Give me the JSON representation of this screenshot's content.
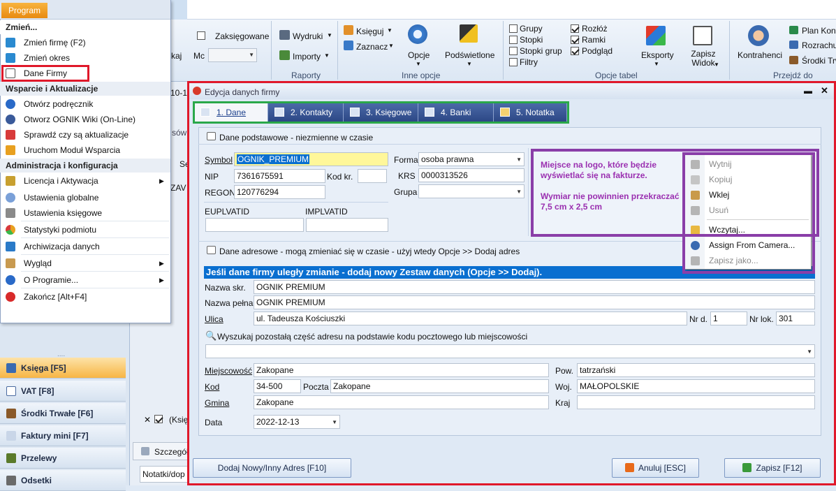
{
  "ribbon": {
    "zaksiegowane": "Zaksięgowane",
    "mc": "Mc",
    "kaj": "kaj",
    "wydruki": "Wydruki",
    "importy": "Importy",
    "raporty": "Raporty",
    "ksieguj": "Księguj",
    "zaznacz": "Zaznacz",
    "opcje": "Opcje",
    "podswietlone": "Podświetlone",
    "inne_opcje": "Inne opcje",
    "grupy": "Grupy",
    "stopki": "Stopki",
    "stopki_grup": "Stopki grup",
    "filtry": "Filtry",
    "rozloz": "Rozłóż",
    "ramki": "Ramki",
    "podglad": "Podgląd",
    "opcje_tabel": "Opcje tabel",
    "eksporty": "Eksporty",
    "zapisz_widok": "Zapisz Widok",
    "kontrahenci": "Kontrahenci",
    "plan_kont": "Plan Kont",
    "rozrachu": "Rozrachu",
    "srodki_trw": "Środki Trw",
    "przejdz_do": "Przejdź do"
  },
  "program_menu": {
    "header": "Program",
    "sections": [
      {
        "title": "Zmień...",
        "items": [
          {
            "label": "Zmień firmę (F2)",
            "icon": "change-icon"
          },
          {
            "label": "Zmień okres",
            "icon": "change-icon"
          },
          {
            "label": "Dane Firmy",
            "icon": "company-card-icon"
          }
        ]
      },
      {
        "title": "Wsparcie i Aktualizacje",
        "items": [
          {
            "label": "Otwórz podręcznik",
            "icon": "help-icon"
          },
          {
            "label": "Otworz OGNIK Wiki (On-Line)",
            "icon": "wiki-icon"
          },
          {
            "label": "Sprawdź czy są aktualizacje",
            "icon": "update-icon"
          },
          {
            "label": "Uruchom Moduł Wsparcia",
            "icon": "support-icon"
          }
        ]
      },
      {
        "title": "Administracja i konfiguracja",
        "items": [
          {
            "label": "Licencja i Aktywacja",
            "icon": "key-icon"
          },
          {
            "label": "Ustawienia globalne",
            "icon": "settings-icon"
          },
          {
            "label": "Ustawienia księgowe",
            "icon": "tools-icon"
          },
          {
            "label": "Statystyki podmiotu",
            "icon": "stats-icon"
          },
          {
            "label": "Archiwizacja danych",
            "icon": "archive-icon"
          },
          {
            "label": "Wygląd",
            "icon": "appearance-icon"
          },
          {
            "label": "O Programie...",
            "icon": "about-icon"
          },
          {
            "label": "Zakończ [Alt+F4]",
            "icon": "power-icon"
          }
        ]
      }
    ]
  },
  "nav": {
    "items": [
      "Księga [F5]",
      "VAT [F8]",
      "Środki Trwałe [F6]",
      "Faktury mini [F7]",
      "Przelewy",
      "Odsetki"
    ]
  },
  "background": {
    "date_frag": "10-1",
    "sow": "sów",
    "se": "Se",
    "zav": "ZAV",
    "ksie": "(Księ",
    "szczegoly": "Szczegóły",
    "notatki": "Notatki/dop"
  },
  "dialog": {
    "title": "Edycja danych firmy",
    "tabs": [
      "1. Dane",
      "2. Kontakty",
      "3. Księgowe",
      "4. Banki",
      "5. Notatka"
    ],
    "section_basic": "Dane podstawowe - niezmienne w czasie",
    "symbol_label": "Symbol",
    "symbol": "OGNIK_PREMIUM",
    "nip_label": "NIP",
    "nip": "7361675591",
    "kodkr_label": "Kod kr.",
    "kodkr": "",
    "regon_label": "REGON",
    "regon": "120776294",
    "forma_label": "Forma",
    "forma": "osoba prawna",
    "krs_label": "KRS",
    "krs": "0000313526",
    "grupa_label": "Grupa",
    "grupa": "",
    "euplvatid_label": "EUPLVATID",
    "euplvatid": "",
    "implvatid_label": "IMPLVATID",
    "implvatid": "",
    "logo_text1": "Miejsce na logo, które będzie wyświetlać się na fakturze.",
    "logo_text2": "Wymiar nie powinnien przekraczać 7,5 cm x 2,5 cm",
    "section_address": "Dane adresowe - mogą zmieniać się w czasie - użyj wtedy Opcje >> Dodaj adres",
    "address_notice": "Jeśli dane firmy uległy zmianie - dodaj nowy Zestaw danych (Opcje >> Dodaj).",
    "nazwa_skr_label": "Nazwa skr.",
    "nazwa_skr": "OGNIK PREMIUM",
    "nazwa_pelna_label": "Nazwa pełna",
    "nazwa_pelna": "OGNIK PREMIUM",
    "ulica_label": "Ulica",
    "ulica": "ul. Tadeusza Kościuszki",
    "nrd_label": "Nr d.",
    "nrd": "1",
    "nrlok_label": "Nr lok.",
    "nrlok": "301",
    "search_label": "Wyszukaj pozostałą część adresu na podstawie kodu pocztowego lub miejscowości",
    "miejscowosc_label": "Miejscowość",
    "miejscowosc": "Zakopane",
    "pow_label": "Pow.",
    "pow": "tatrzański",
    "kod_label": "Kod",
    "kod": "34-500",
    "poczta_label": "Poczta",
    "poczta": "Zakopane",
    "woj_label": "Woj.",
    "woj": "MAŁOPOLSKIE",
    "gmina_label": "Gmina",
    "gmina": "Zakopane",
    "kraj_label": "Kraj",
    "kraj": "",
    "data_label": "Data",
    "data": "2022-12-13",
    "btn_add": "Dodaj Nowy/Inny Adres [F10]",
    "btn_cancel": "Anuluj [ESC]",
    "btn_save": "Zapisz [F12]"
  },
  "context_menu": {
    "items": [
      {
        "label": "Wytnij",
        "icon": "cut-icon",
        "enabled": false
      },
      {
        "label": "Kopiuj",
        "icon": "copy-icon",
        "enabled": false
      },
      {
        "label": "Wklej",
        "icon": "paste-icon",
        "enabled": true
      },
      {
        "label": "Usuń",
        "icon": "delete-icon",
        "enabled": false
      },
      {
        "label": "Wczytaj...",
        "icon": "folder-icon",
        "enabled": true
      },
      {
        "label": "Assign From Camera...",
        "icon": "camera-icon",
        "enabled": true
      },
      {
        "label": "Zapisz jako...",
        "icon": "save-icon",
        "enabled": false
      }
    ]
  },
  "colors": {
    "highlight_red": "#e0182a",
    "highlight_green": "#2aa84a",
    "highlight_purple": "#8a3ea8",
    "selection_blue": "#0a6fd0",
    "symbol_bg": "#fff79a",
    "logo_text": "#9a2fb0"
  }
}
